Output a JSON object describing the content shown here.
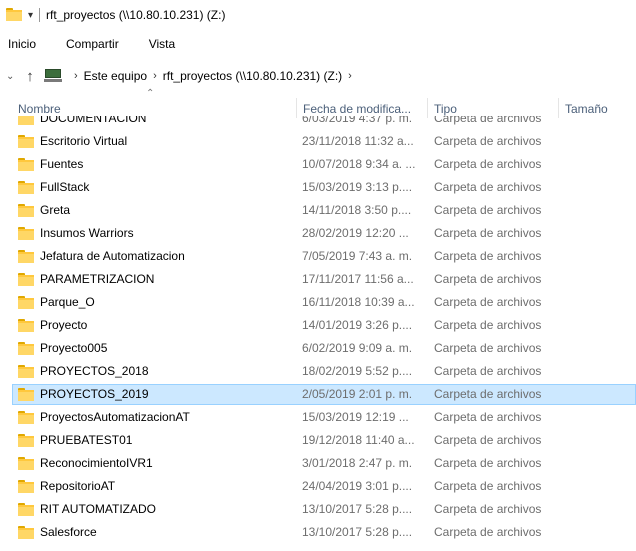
{
  "window": {
    "title": "rft_proyectos (\\\\10.80.10.231) (Z:)"
  },
  "ribbon": {
    "tabs": [
      "Inicio",
      "Compartir",
      "Vista"
    ]
  },
  "address": {
    "breadcrumb": [
      "Este equipo",
      "rft_proyectos (\\\\10.80.10.231) (Z:)"
    ]
  },
  "columns": {
    "name": "Nombre",
    "date": "Fecha de modifica...",
    "type": "Tipo",
    "size": "Tamaño"
  },
  "files": [
    {
      "name": "DOCUMENTACION",
      "date": "6/03/2019 4:37 p. m.",
      "type": "Carpeta de archivos"
    },
    {
      "name": "Escritorio Virtual",
      "date": "23/11/2018 11:32 a...",
      "type": "Carpeta de archivos"
    },
    {
      "name": "Fuentes",
      "date": "10/07/2018 9:34 a. ...",
      "type": "Carpeta de archivos"
    },
    {
      "name": "FullStack",
      "date": "15/03/2019 3:13 p....",
      "type": "Carpeta de archivos"
    },
    {
      "name": "Greta",
      "date": "14/11/2018 3:50 p....",
      "type": "Carpeta de archivos"
    },
    {
      "name": "Insumos Warriors",
      "date": "28/02/2019 12:20 ...",
      "type": "Carpeta de archivos"
    },
    {
      "name": "Jefatura de Automatizacion",
      "date": "7/05/2019 7:43 a. m.",
      "type": "Carpeta de archivos"
    },
    {
      "name": "PARAMETRIZACION",
      "date": "17/11/2017 11:56 a...",
      "type": "Carpeta de archivos"
    },
    {
      "name": "Parque_O",
      "date": "16/11/2018 10:39 a...",
      "type": "Carpeta de archivos"
    },
    {
      "name": "Proyecto",
      "date": "14/01/2019 3:26 p....",
      "type": "Carpeta de archivos"
    },
    {
      "name": "Proyecto005",
      "date": "6/02/2019 9:09 a. m.",
      "type": "Carpeta de archivos"
    },
    {
      "name": "PROYECTOS_2018",
      "date": "18/02/2019 5:52 p....",
      "type": "Carpeta de archivos"
    },
    {
      "name": "PROYECTOS_2019",
      "date": "2/05/2019 2:01 p. m.",
      "type": "Carpeta de archivos",
      "selected": true
    },
    {
      "name": "ProyectosAutomatizacionAT",
      "date": "15/03/2019 12:19 ...",
      "type": "Carpeta de archivos"
    },
    {
      "name": "PRUEBATEST01",
      "date": "19/12/2018 11:40 a...",
      "type": "Carpeta de archivos"
    },
    {
      "name": "ReconocimientoIVR1",
      "date": "3/01/2018 2:47 p. m.",
      "type": "Carpeta de archivos"
    },
    {
      "name": "RepositorioAT",
      "date": "24/04/2019 3:01 p....",
      "type": "Carpeta de archivos"
    },
    {
      "name": "RIT AUTOMATIZADO",
      "date": "13/10/2017 5:28 p....",
      "type": "Carpeta de archivos"
    },
    {
      "name": "Salesforce",
      "date": "13/10/2017 5:28 p....",
      "type": "Carpeta de archivos"
    }
  ],
  "icons": {
    "folder": "folder-icon",
    "pc": "pc-icon",
    "up": "up-arrow-icon",
    "chevron": "chevron-down-icon",
    "breadcrumb-separator": "chevron-right-icon",
    "sort": "sort-up-caret-icon"
  },
  "colors": {
    "selection_bg": "#cce8ff",
    "selection_border": "#99d1ff",
    "header_text": "#4c607a",
    "meta_text": "#6d6d6d",
    "folder": "#ffc83d"
  }
}
